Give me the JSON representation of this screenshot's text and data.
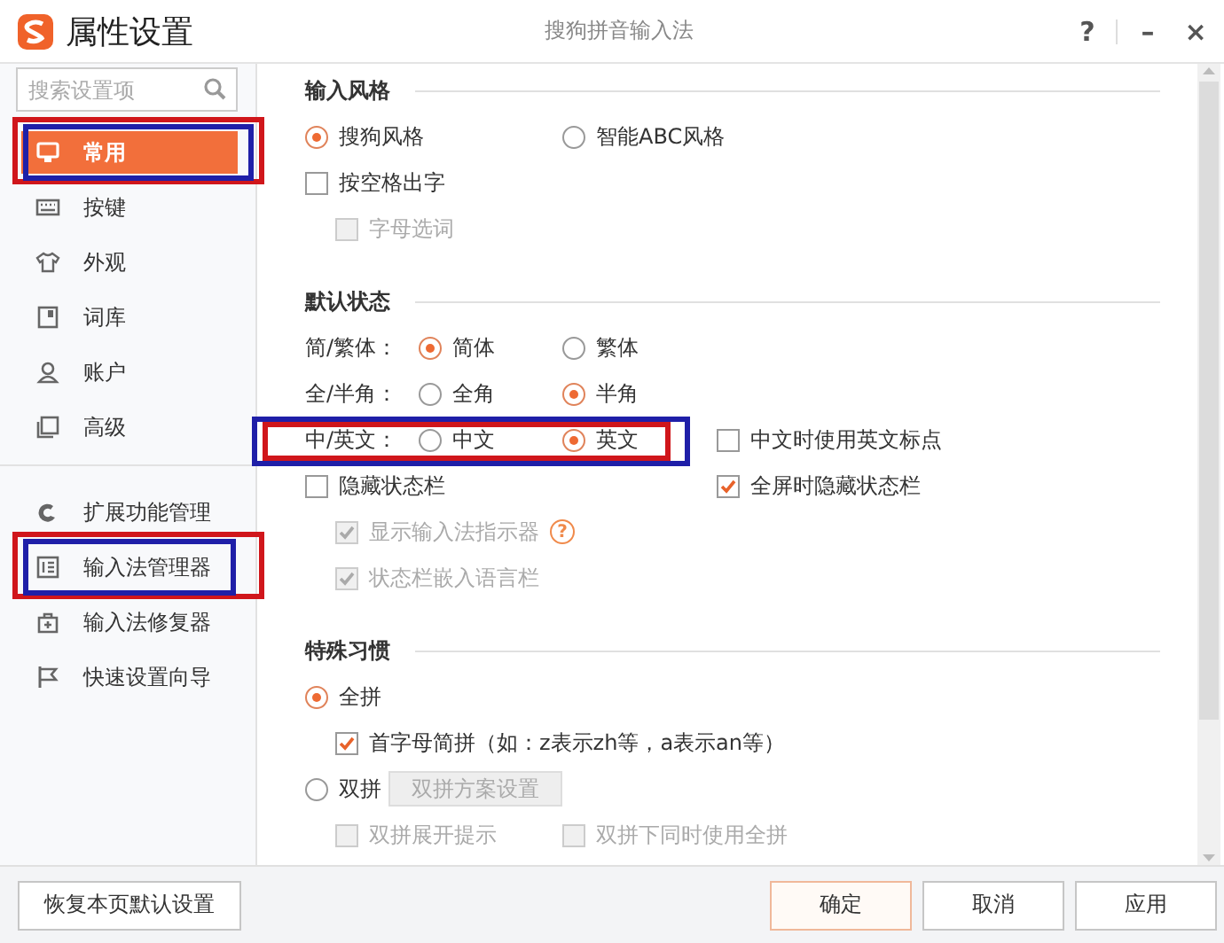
{
  "window": {
    "title": "属性设置",
    "app_name": "搜狗拼音输入法",
    "controls": [
      "?",
      "–",
      "×"
    ]
  },
  "search": {
    "placeholder": "搜索设置项"
  },
  "sidebar": {
    "groups": [
      [
        {
          "label": "常用",
          "selected": true,
          "highlight": [
            {
              "color": "#d0161b"
            },
            {
              "color": "#1f1fa8"
            }
          ]
        },
        {
          "label": "按键",
          "selected": false
        },
        {
          "label": "外观",
          "selected": false
        },
        {
          "label": "词库",
          "selected": false
        },
        {
          "label": "账户",
          "selected": false
        },
        {
          "label": "高级",
          "selected": false
        }
      ],
      [
        {
          "label": "扩展功能管理",
          "selected": false
        },
        {
          "label": "输入法管理器",
          "selected": false,
          "highlight": [
            {
              "color": "#d0161b"
            },
            {
              "color": "#1f1fa8"
            }
          ]
        },
        {
          "label": "输入法修复器",
          "selected": false
        },
        {
          "label": "快速设置向导",
          "selected": false
        }
      ]
    ]
  },
  "sections": [
    {
      "title": "输入风格",
      "rows": [
        {
          "items": [
            {
              "kind": "radio",
              "label": "搜狗风格",
              "selected": true,
              "disabled": false
            },
            {
              "kind": "radio",
              "label": "智能ABC风格",
              "selected": false,
              "disabled": false
            }
          ]
        },
        {
          "items": [
            {
              "kind": "checkbox",
              "label": "按空格出字",
              "checked": false,
              "disabled": false
            }
          ],
          "children": [
            {
              "items": [
                {
                  "kind": "checkbox",
                  "label": "字母选词",
                  "checked": false,
                  "disabled": true
                }
              ]
            }
          ]
        }
      ]
    },
    {
      "title": "默认状态",
      "rows": [
        {
          "label": "简/繁体：",
          "items": [
            {
              "kind": "radio",
              "label": "简体",
              "selected": true,
              "disabled": false
            },
            {
              "kind": "radio",
              "label": "繁体",
              "selected": false,
              "disabled": false
            }
          ]
        },
        {
          "label": "全/半角：",
          "items": [
            {
              "kind": "radio",
              "label": "全角",
              "selected": false,
              "disabled": false
            },
            {
              "kind": "radio",
              "label": "半角",
              "selected": true,
              "disabled": false
            }
          ]
        },
        {
          "label": "中/英文：",
          "items": [
            {
              "kind": "radio",
              "label": "中文",
              "selected": false,
              "disabled": false
            },
            {
              "kind": "radio",
              "label": "英文",
              "selected": true,
              "disabled": false
            }
          ],
          "side": {
            "kind": "checkbox",
            "label": "中文时使用英文标点",
            "checked": false,
            "disabled": false
          },
          "highlight": [
            {
              "color": "#1f1fa8"
            },
            {
              "color": "#d0161b"
            }
          ]
        },
        {
          "items": [
            {
              "kind": "checkbox",
              "label": "隐藏状态栏",
              "checked": false,
              "disabled": false
            }
          ],
          "side": {
            "kind": "checkbox",
            "label": "全屏时隐藏状态栏",
            "checked": true,
            "disabled": false
          },
          "children": [
            {
              "items": [
                {
                  "kind": "checkbox",
                  "label": "显示输入法指示器",
                  "checked": true,
                  "disabled": true
                },
                {
                  "kind": "help",
                  "label": "?"
                }
              ]
            },
            {
              "items": [
                {
                  "kind": "checkbox",
                  "label": "状态栏嵌入语言栏",
                  "checked": true,
                  "disabled": true
                }
              ]
            }
          ]
        }
      ]
    },
    {
      "title": "特殊习惯",
      "rows": [
        {
          "items": [
            {
              "kind": "radio",
              "label": "全拼",
              "selected": true,
              "disabled": false
            }
          ],
          "children": [
            {
              "items": [
                {
                  "kind": "checkbox",
                  "label": "首字母简拼（如：z表示zh等，a表示an等）",
                  "checked": true,
                  "disabled": false
                }
              ]
            }
          ]
        },
        {
          "items": [
            {
              "kind": "radio",
              "label": "双拼",
              "selected": false,
              "disabled": false
            },
            {
              "kind": "button",
              "label": "双拼方案设置",
              "disabled": true
            }
          ],
          "children": [
            {
              "items": [
                {
                  "kind": "checkbox",
                  "label": "双拼展开提示",
                  "checked": false,
                  "disabled": true
                },
                {
                  "kind": "checkbox",
                  "label": "双拼下同时使用全拼",
                  "checked": false,
                  "disabled": true
                }
              ]
            }
          ]
        }
      ]
    }
  ],
  "footer": {
    "reset": "恢复本页默认设置",
    "buttons": [
      {
        "label": "确定",
        "kind": "primary"
      },
      {
        "label": "取消",
        "kind": "normal"
      },
      {
        "label": "应用",
        "kind": "normal"
      }
    ]
  }
}
